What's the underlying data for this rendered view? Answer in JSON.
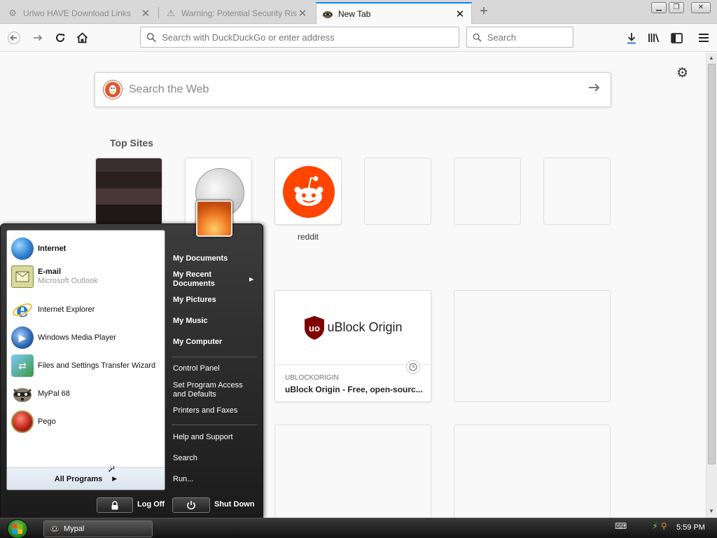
{
  "browser": {
    "tabs": [
      {
        "title": "Urlwo HAVE Download Links",
        "icon": "gear-icon",
        "active": false
      },
      {
        "title": "Warning: Potential Security Risk",
        "icon": "warning-icon",
        "active": false
      },
      {
        "title": "New Tab",
        "icon": "raccoon-icon",
        "active": true
      }
    ],
    "url_placeholder": "Search with DuckDuckGo or enter address",
    "search_placeholder": "Search"
  },
  "newtab": {
    "search_placeholder": "Search the Web",
    "top_sites_title": "Top Sites",
    "top_sites": [
      {
        "label": "",
        "kind": "thumbnail"
      },
      {
        "label": "",
        "kind": "wikipedia"
      },
      {
        "label": "reddit",
        "kind": "reddit"
      },
      {
        "label": "",
        "kind": "empty"
      },
      {
        "label": "",
        "kind": "empty"
      },
      {
        "label": "",
        "kind": "empty"
      }
    ],
    "highlight": {
      "name": "uBlock Origin",
      "source": "UBLOCKORIGIN",
      "title": "uBlock Origin - Free, open-sourc..."
    }
  },
  "start_menu": {
    "left_items": [
      {
        "name": "Internet",
        "sub": "",
        "bold": true,
        "icon": "globe-icon",
        "color": "#2f7fd0"
      },
      {
        "name": "E-mail",
        "sub": "Microsoft Outlook",
        "bold": true,
        "icon": "email-icon",
        "color": "#8a8a3a"
      },
      {
        "name": "Internet Explorer",
        "sub": "",
        "bold": false,
        "icon": "ie-icon",
        "color": "#2a79c8"
      },
      {
        "name": "Windows Media Player",
        "sub": "",
        "bold": false,
        "icon": "media-player-icon",
        "color": "#2a62b0"
      },
      {
        "name": "Files and Settings Transfer Wizard",
        "sub": "",
        "bold": false,
        "icon": "transfer-wizard-icon",
        "color": "#3a9a40"
      },
      {
        "name": "MyPal 68",
        "sub": "",
        "bold": false,
        "icon": "raccoon-icon",
        "color": "#6a5a4a"
      },
      {
        "name": "Pego",
        "sub": "",
        "bold": false,
        "icon": "pego-icon",
        "color": "#c0271c"
      }
    ],
    "all_programs": "All Programs",
    "right_items": [
      "My Documents",
      "My Recent Documents",
      "My Pictures",
      "My Music",
      "My Computer",
      "Control Panel",
      "Set Program Access and Defaults",
      "Printers and Faxes",
      "Help and Support",
      "Search",
      "Run..."
    ],
    "log_off": "Log Off",
    "shut_down": "Shut Down"
  },
  "taskbar": {
    "task": "Mypal",
    "clock": "5:59 PM"
  }
}
